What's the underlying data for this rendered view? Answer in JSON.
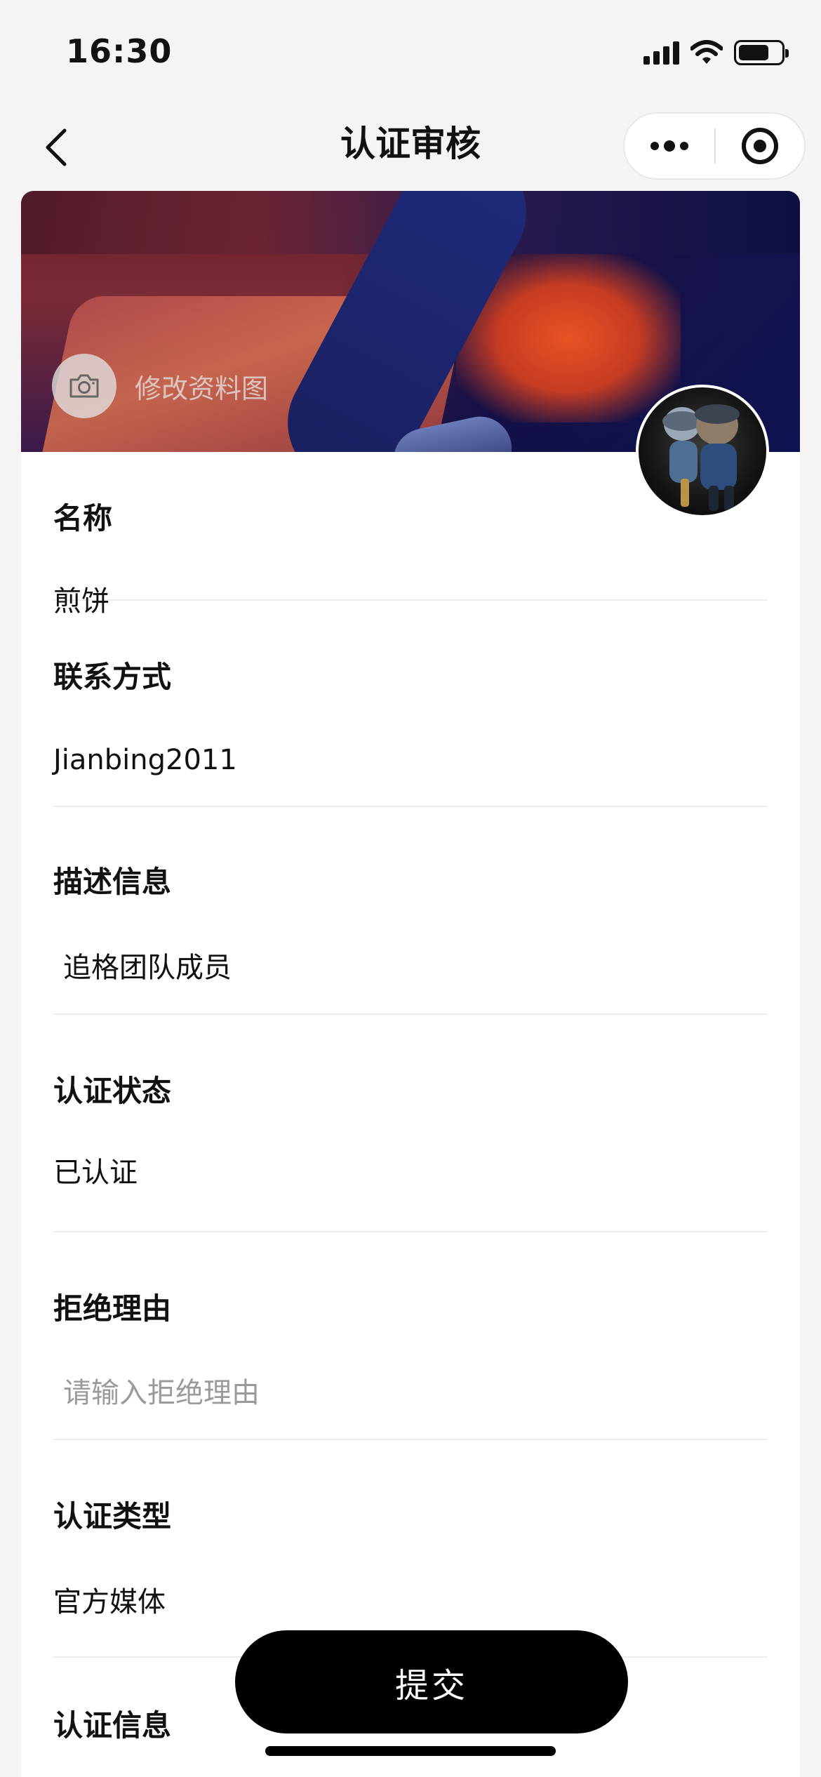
{
  "status_bar": {
    "time": "16:30",
    "battery_level": 0.72
  },
  "nav": {
    "title": "认证审核",
    "back_icon": "chevron-left-icon",
    "more_icon": "more-dots-icon",
    "close_icon": "target-ring-icon"
  },
  "cover": {
    "edit_label": "修改资料图",
    "camera_icon": "camera-icon"
  },
  "fields": [
    {
      "label": "名称",
      "value": "煎饼"
    },
    {
      "label": "联系方式",
      "value": "Jianbing2011"
    },
    {
      "label": "描述信息",
      "value": "追格团队成员"
    },
    {
      "label": "认证状态",
      "value": "已认证"
    },
    {
      "label": "拒绝理由",
      "placeholder": "请输入拒绝理由"
    },
    {
      "label": "认证类型",
      "value": "官方媒体"
    },
    {
      "label": "认证信息"
    }
  ],
  "submit_label": "提交"
}
